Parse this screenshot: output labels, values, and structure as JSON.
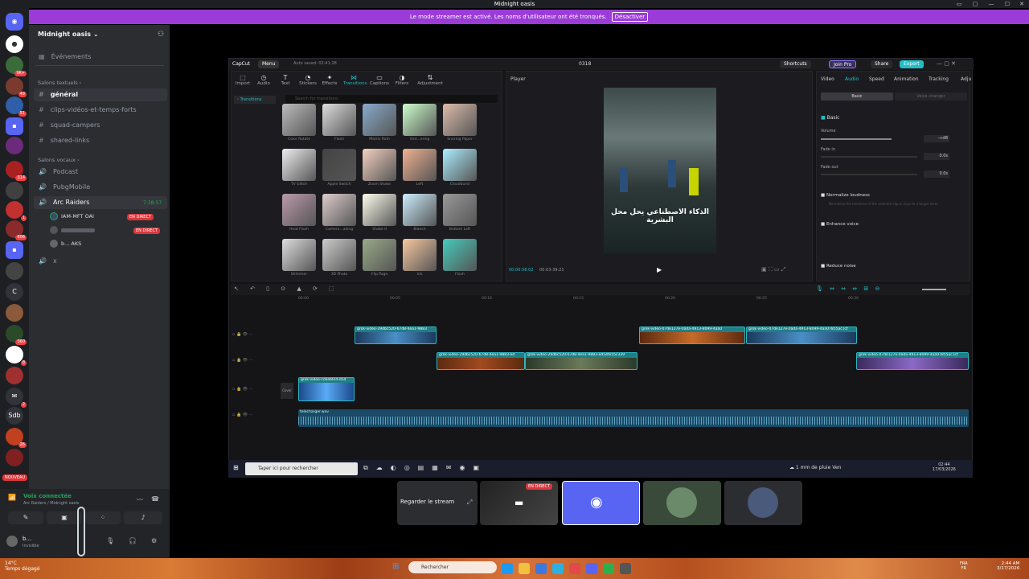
{
  "window": {
    "title": "Midnight oasis"
  },
  "banner": {
    "text": "Le mode streamer est activé. Les noms d'utilisateur ont été tronqués.",
    "button": "Désactiver"
  },
  "server": {
    "name": "Midnight oasis"
  },
  "channels": {
    "events": "Événements",
    "text_category": "Salons textuels",
    "text": [
      "général",
      "clips-vidéos-et-temps-forts",
      "squad-campers",
      "shared-links"
    ],
    "voice_category": "Salons vocaux",
    "voice": [
      "Podcast",
      "PubgMobile",
      "Arc Raiders",
      "x"
    ],
    "arc_time": "7:38:57",
    "members": [
      {
        "name": "IAM-MFT",
        "tag": "OAI",
        "live": "EN DIRECT"
      },
      {
        "name": "",
        "live": "EN DIRECT"
      },
      {
        "name": "b...",
        "tag": "AKS"
      }
    ]
  },
  "servers": {
    "badges": [
      "9K+",
      "49",
      "51",
      "314",
      "1",
      "806",
      "360",
      "8",
      "2",
      "26"
    ],
    "labels": [
      "C",
      "Sdb"
    ],
    "new_label": "NOUVEAU"
  },
  "voice_panel": {
    "status": "Voix connectée",
    "sub": "Arc Raiders / Midnight oasis",
    "user": "b...",
    "user_status": "Invisible"
  },
  "capcut": {
    "logo": "CapCut",
    "menu": "Menu",
    "autosave": "Auto saved: 02:41:28",
    "project": "0318",
    "shortcuts": "Shortcuts",
    "join_pro": "Join Pro",
    "share": "Share",
    "export": "Export",
    "tools": [
      "Import",
      "Audio",
      "Text",
      "Stickers",
      "Effects",
      "Transitions",
      "Captions",
      "Filters",
      "Adjustment"
    ],
    "sidebar_item": "Transitions",
    "search_placeholder": "Search for transitions",
    "grid_labels": [
      "Color Rotate",
      "Flash",
      "Matrix Rain",
      "Vint...ering",
      "Snaring Paper",
      "TV Glitch",
      "Apple Switch",
      "Zoom Shake",
      "Left",
      "Cloudburst",
      "Heat Flash",
      "Camera...aking",
      "Shake II",
      "Blanch",
      "Bottom Left",
      "Shimmer",
      "3D Photo",
      "Flip Page",
      "Ink",
      "Flash"
    ],
    "player": {
      "label": "Player",
      "caption": "الذكاء الاصطناعي يحل محل البشرية",
      "time_current": "00:00:58:02",
      "time_total": "00:03:39:21"
    },
    "props": {
      "tabs": [
        "Video",
        "Audio",
        "Speed",
        "Animation",
        "Tracking",
        "Adju"
      ],
      "sub": [
        "Basic",
        "Voice changer"
      ],
      "basic": "Basic",
      "volume": "Volume",
      "volume_val": "-∞dB",
      "fade_in": "Fade in",
      "fade_in_val": "0.0s",
      "fade_out": "Fade out",
      "fade_out_val": "0.0s",
      "normalize": "Normalize loudness",
      "normalize_desc": "Normalize the loudness of the selected clip or clips to a target level.",
      "enhance": "Enhance voice",
      "reduce": "Reduce noise"
    },
    "timeline": {
      "ticks": [
        "00:00",
        "00:05",
        "00:10",
        "00:15",
        "00:20",
        "00:25",
        "00:30"
      ],
      "clips": [
        "grok-video-29dbc520-67d8-4ea1-9883",
        "grok-video-07de127e-0ada-4913-8099-4aa0",
        "grok-video-07de127e-0ada-4913-8099-4aa07855ac.lct",
        "grok-video-29dbc520-67d8-4ea1-9883-ed",
        "grok-video-29dbc520-67d8-4ea1-9883-ed54fe55c339",
        "grok-video-07de127e-0ada-4913-8099-4aa07855ac.lct",
        "grok-video-ccba6f2d-d1d"
      ],
      "audio": "telecharger.wav",
      "cover": "Cover"
    }
  },
  "inner_taskbar": {
    "search": "Taper ici pour rechercher",
    "weather": "1 mm de pluie Ven",
    "time": "02:44",
    "date": "17/03/2026"
  },
  "stream_tiles": {
    "watch": "Regarder le stream",
    "live": "EN DIRECT"
  },
  "windows": {
    "weather_temp": "14°C",
    "weather_desc": "Temps dégagé",
    "search": "Rechercher",
    "lang": "FRA",
    "lang2": "FR",
    "time": "2:44 AM",
    "date": "3/17/2026"
  }
}
